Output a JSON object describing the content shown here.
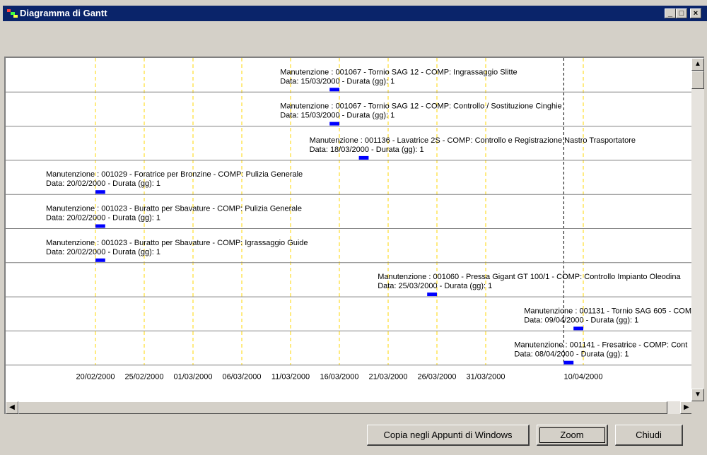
{
  "window": {
    "title": "Diagramma di Gantt",
    "controls": {
      "minimize": "_",
      "maximize": "□",
      "close": "×"
    }
  },
  "colors": {
    "titlebar": "#0a246a",
    "bar": "#0000ff",
    "gridline": "#ffd700",
    "today_line": "#000000"
  },
  "chart_data": {
    "type": "gantt",
    "x_ticks": [
      "20/02/2000",
      "25/02/2000",
      "01/03/2000",
      "06/03/2000",
      "11/03/2000",
      "16/03/2000",
      "21/03/2000",
      "26/03/2000",
      "31/03/2000",
      "10/04/2000"
    ],
    "today": "08/04/2000",
    "tasks": [
      {
        "label": "Manutenzione : 001067 - Tornio SAG 12 - COMP: Ingrassaggio Slitte",
        "detail": "Data: 15/03/2000 - Durata (gg): 1",
        "date": "15/03/2000",
        "duration_days": 1
      },
      {
        "label": "Manutenzione : 001067 - Tornio SAG 12 - COMP: Controllo / Sostituzione Cinghie",
        "detail": "Data: 15/03/2000 - Durata (gg): 1",
        "date": "15/03/2000",
        "duration_days": 1
      },
      {
        "label": "Manutenzione : 001136 - Lavatrice 2S - COMP: Controllo e Registrazione Nastro Trasportatore",
        "detail": "Data: 18/03/2000 - Durata (gg): 1",
        "date": "18/03/2000",
        "duration_days": 1
      },
      {
        "label": "Manutenzione : 001029 - Foratrice per Bronzine - COMP: Pulizia Generale",
        "detail": "Data: 20/02/2000 - Durata (gg): 1",
        "date": "20/02/2000",
        "duration_days": 1
      },
      {
        "label": "Manutenzione : 001023 - Buratto per Sbavature - COMP: Pulizia Generale",
        "detail": "Data: 20/02/2000 - Durata (gg): 1",
        "date": "20/02/2000",
        "duration_days": 1
      },
      {
        "label": "Manutenzione : 001023 - Buratto per Sbavature - COMP: Igrassaggio Guide",
        "detail": "Data: 20/02/2000 - Durata (gg): 1",
        "date": "20/02/2000",
        "duration_days": 1
      },
      {
        "label": "Manutenzione : 001060 - Pressa Gigant GT 100/1 - COMP: Controllo Impianto Oleodina",
        "detail": "Data: 25/03/2000 - Durata (gg): 1",
        "date": "25/03/2000",
        "duration_days": 1
      },
      {
        "label": "Manutenzione : 001131 - Tornio SAG 605 - COM",
        "detail": "Data: 09/04/2000 - Durata (gg): 1",
        "date": "09/04/2000",
        "duration_days": 1
      },
      {
        "label": "Manutenzione : 001141 - Fresatrice - COMP: Cont",
        "detail": "Data: 08/04/2000 - Durata (gg): 1",
        "date": "08/04/2000",
        "duration_days": 1
      }
    ]
  },
  "buttons": {
    "copy": "Copia negli Appunti di Windows",
    "zoom": "Zoom",
    "close": "Chiudi"
  },
  "scrollbars": {
    "up": "▲",
    "down": "▼",
    "left": "◀",
    "right": "▶"
  }
}
